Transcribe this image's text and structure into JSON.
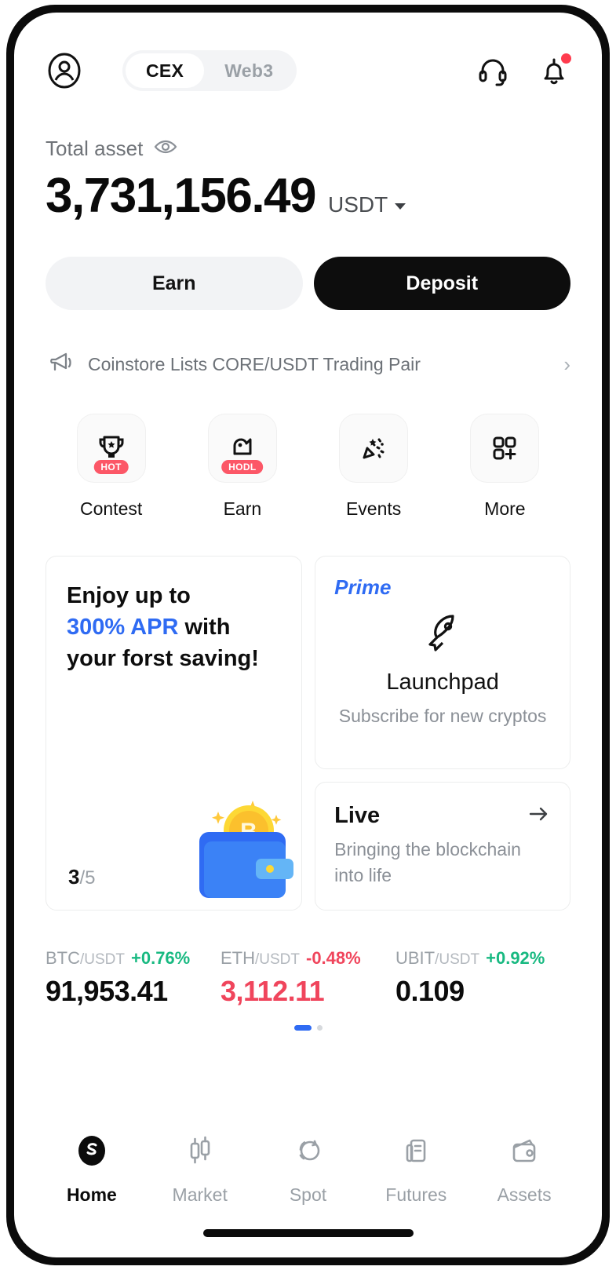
{
  "header": {
    "profile_icon": "user-circle-icon",
    "segments": [
      {
        "label": "CEX",
        "active": true
      },
      {
        "label": "Web3",
        "active": false
      }
    ],
    "support_icon": "headset-icon",
    "notification_icon": "bell-icon",
    "has_notification": true
  },
  "balance": {
    "label": "Total asset",
    "eye_icon": "eye-icon",
    "amount": "3,731,156.49",
    "currency": "USDT"
  },
  "actions": {
    "earn_label": "Earn",
    "deposit_label": "Deposit"
  },
  "announcement": {
    "icon": "megaphone-icon",
    "text": "Coinstore Lists CORE/USDT Trading Pair",
    "chevron": "›"
  },
  "quick_actions": [
    {
      "label": "Contest",
      "icon": "trophy-icon",
      "badge": "HOT"
    },
    {
      "label": "Earn",
      "icon": "piggy-bank-icon",
      "badge": "HODL"
    },
    {
      "label": "Events",
      "icon": "party-popper-icon",
      "badge": ""
    },
    {
      "label": "More",
      "icon": "grid-plus-icon",
      "badge": ""
    }
  ],
  "promo": {
    "savings": {
      "line1": "Enjoy up to",
      "highlight": "300% APR",
      "line2_rest": " with",
      "line3": "your forst saving!",
      "counter_current": "3",
      "counter_total": "/5",
      "art": "wallet-bitcoin-icon"
    },
    "launchpad": {
      "tag": "Prime",
      "icon": "rocket-icon",
      "title": "Launchpad",
      "subtitle": "Subscribe for new cryptos"
    },
    "live": {
      "title": "Live",
      "arrow_icon": "arrow-right-icon",
      "subtitle": "Bringing the blockchain into life"
    }
  },
  "tickers": [
    {
      "base": "BTC",
      "quote": "/USDT",
      "change": "+0.76%",
      "direction": "up",
      "price": "91,953.41",
      "price_direction": "neutral"
    },
    {
      "base": "ETH",
      "quote": "/USDT",
      "change": "-0.48%",
      "direction": "down",
      "price": "3,112.11",
      "price_direction": "down"
    },
    {
      "base": "UBIT",
      "quote": "/USDT",
      "change": "+0.92%",
      "direction": "up",
      "price": "0.109",
      "price_direction": "neutral"
    }
  ],
  "ticker_pagination": {
    "total": 2,
    "active_index": 0
  },
  "bottom_nav": [
    {
      "label": "Home",
      "icon": "home-logo-icon",
      "active": true
    },
    {
      "label": "Market",
      "icon": "candlestick-icon",
      "active": false
    },
    {
      "label": "Spot",
      "icon": "swap-circles-icon",
      "active": false
    },
    {
      "label": "Futures",
      "icon": "document-icon",
      "active": false
    },
    {
      "label": "Assets",
      "icon": "wallet-icon",
      "active": false
    }
  ],
  "colors": {
    "accent_blue": "#2f6bf3",
    "up_green": "#18b981",
    "down_red": "#f0455c",
    "badge_red": "#fc5767",
    "dark": "#0d0d0d"
  }
}
